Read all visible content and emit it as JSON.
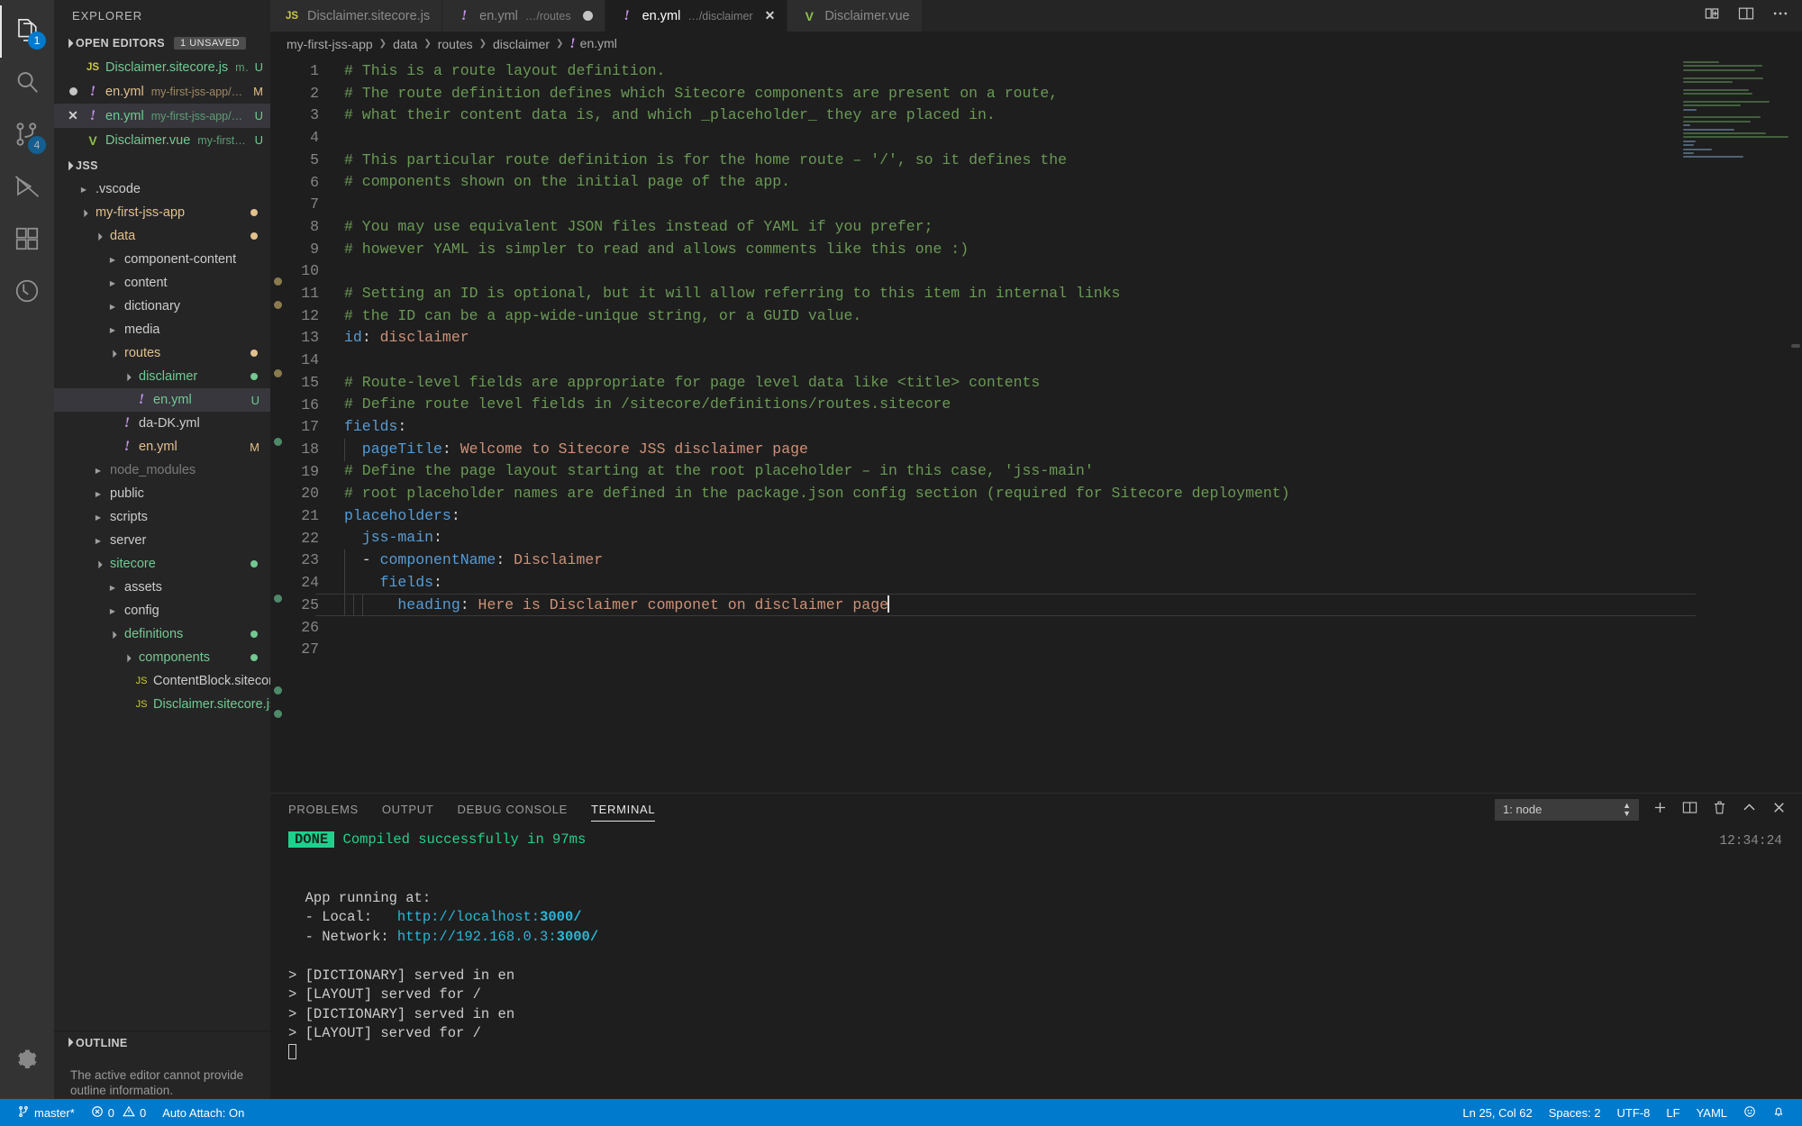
{
  "activitybar": {
    "items": [
      {
        "name": "explorer",
        "icon": "files-icon",
        "badge": "1",
        "active": true
      },
      {
        "name": "search",
        "icon": "search-icon",
        "badge": null,
        "active": false
      },
      {
        "name": "source-control",
        "icon": "source-control-icon",
        "badge": "4",
        "active": false
      },
      {
        "name": "run-debug",
        "icon": "run-debug-icon",
        "badge": null,
        "active": false
      },
      {
        "name": "extensions",
        "icon": "extensions-icon",
        "badge": null,
        "active": false
      },
      {
        "name": "test",
        "icon": "beaker-icon",
        "badge": null,
        "active": false
      }
    ],
    "bottom": [
      {
        "name": "manage-settings",
        "icon": "gear-icon"
      }
    ]
  },
  "sidebar": {
    "title": "EXPLORER",
    "open_editors": {
      "label": "OPEN EDITORS",
      "badge": "1 UNSAVED",
      "items": [
        {
          "action": "",
          "icon": "js-icon",
          "name": "Disclaimer.sitecore.js",
          "path": "my-first…",
          "flag": "U",
          "name_color": "green",
          "path_color": "green",
          "selected": false
        },
        {
          "action": "dot",
          "icon": "yml-icon",
          "name": "en.yml",
          "path": "my-first-jss-app/data/r…",
          "flag": "M",
          "name_color": "orange",
          "path_color": "orange",
          "selected": false
        },
        {
          "action": "close",
          "icon": "yml-icon",
          "name": "en.yml",
          "path": "my-first-jss-app/data/ro…",
          "flag": "U",
          "name_color": "green",
          "path_color": "green",
          "selected": true
        },
        {
          "action": "",
          "icon": "vue-icon",
          "name": "Disclaimer.vue",
          "path": "my-first-jss-ap…",
          "flag": "U",
          "name_color": "green",
          "path_color": "green",
          "selected": false
        }
      ]
    },
    "workspace": {
      "label": "JSS",
      "tree": [
        {
          "depth": 1,
          "arrow": "closed",
          "label": ".vscode",
          "color": "#cccccc",
          "flag": "",
          "dot": ""
        },
        {
          "depth": 1,
          "arrow": "open",
          "label": "my-first-jss-app",
          "color": "#e2c08d",
          "flag": "",
          "dot": "#e2c08d"
        },
        {
          "depth": 2,
          "arrow": "open",
          "label": "data",
          "color": "#e2c08d",
          "flag": "",
          "dot": "#e2c08d"
        },
        {
          "depth": 3,
          "arrow": "closed",
          "label": "component-content",
          "color": "#cccccc",
          "flag": "",
          "dot": ""
        },
        {
          "depth": 3,
          "arrow": "closed",
          "label": "content",
          "color": "#cccccc",
          "flag": "",
          "dot": ""
        },
        {
          "depth": 3,
          "arrow": "closed",
          "label": "dictionary",
          "color": "#cccccc",
          "flag": "",
          "dot": ""
        },
        {
          "depth": 3,
          "arrow": "closed",
          "label": "media",
          "color": "#cccccc",
          "flag": "",
          "dot": ""
        },
        {
          "depth": 3,
          "arrow": "open",
          "label": "routes",
          "color": "#e2c08d",
          "flag": "",
          "dot": "#e2c08d"
        },
        {
          "depth": 4,
          "arrow": "open",
          "label": "disclaimer",
          "color": "#73c991",
          "flag": "",
          "dot": "#73c991"
        },
        {
          "depth": 5,
          "arrow": "file-yml",
          "label": "en.yml",
          "color": "#73c991",
          "flag": "U",
          "dot": "",
          "selected": true
        },
        {
          "depth": 4,
          "arrow": "file-yml",
          "label": "da-DK.yml",
          "color": "#cccccc",
          "flag": "",
          "dot": ""
        },
        {
          "depth": 4,
          "arrow": "file-yml",
          "label": "en.yml",
          "color": "#e2c08d",
          "flag": "M",
          "dot": ""
        },
        {
          "depth": 2,
          "arrow": "closed",
          "label": "node_modules",
          "color": "#7a7a7a",
          "flag": "",
          "dot": ""
        },
        {
          "depth": 2,
          "arrow": "closed",
          "label": "public",
          "color": "#cccccc",
          "flag": "",
          "dot": ""
        },
        {
          "depth": 2,
          "arrow": "closed",
          "label": "scripts",
          "color": "#cccccc",
          "flag": "",
          "dot": ""
        },
        {
          "depth": 2,
          "arrow": "closed",
          "label": "server",
          "color": "#cccccc",
          "flag": "",
          "dot": ""
        },
        {
          "depth": 2,
          "arrow": "open",
          "label": "sitecore",
          "color": "#73c991",
          "flag": "",
          "dot": "#73c991"
        },
        {
          "depth": 3,
          "arrow": "closed",
          "label": "assets",
          "color": "#cccccc",
          "flag": "",
          "dot": ""
        },
        {
          "depth": 3,
          "arrow": "closed",
          "label": "config",
          "color": "#cccccc",
          "flag": "",
          "dot": ""
        },
        {
          "depth": 3,
          "arrow": "open",
          "label": "definitions",
          "color": "#73c991",
          "flag": "",
          "dot": "#73c991"
        },
        {
          "depth": 4,
          "arrow": "open",
          "label": "components",
          "color": "#73c991",
          "flag": "",
          "dot": "#73c991"
        },
        {
          "depth": 5,
          "arrow": "file-js",
          "label": "ContentBlock.sitecore.js",
          "color": "#cccccc",
          "flag": "",
          "dot": ""
        },
        {
          "depth": 5,
          "arrow": "file-js",
          "label": "Disclaimer.sitecore.js",
          "color": "#73c991",
          "flag": "U",
          "dot": ""
        }
      ]
    },
    "outline": {
      "label": "OUTLINE",
      "message": "The active editor cannot provide outline information."
    }
  },
  "tabs": [
    {
      "icon": "js-icon",
      "label": "Disclaimer.sitecore.js",
      "sub": "",
      "state": "",
      "active": false
    },
    {
      "icon": "yml-icon",
      "label": "en.yml",
      "sub": "…/routes",
      "state": "dirty",
      "active": false
    },
    {
      "icon": "yml-icon",
      "label": "en.yml",
      "sub": "…/disclaimer",
      "state": "close",
      "active": true
    },
    {
      "icon": "vue-icon",
      "label": "Disclaimer.vue",
      "sub": "",
      "state": "",
      "active": false
    }
  ],
  "tab_actions": [
    {
      "name": "split-editor-icon"
    },
    {
      "name": "layout-icon"
    },
    {
      "name": "more-actions-icon"
    }
  ],
  "breadcrumbs": [
    {
      "label": "my-first-jss-app",
      "icon": ""
    },
    {
      "label": "data",
      "icon": ""
    },
    {
      "label": "routes",
      "icon": ""
    },
    {
      "label": "disclaimer",
      "icon": ""
    },
    {
      "label": "en.yml",
      "icon": "yml-icon"
    }
  ],
  "editor": {
    "language": "yaml",
    "lines": [
      {
        "n": 1,
        "tokens": [
          {
            "t": "# This is a route layout definition.",
            "c": "comment"
          }
        ]
      },
      {
        "n": 2,
        "tokens": [
          {
            "t": "# The route definition defines which Sitecore components are present on a route,",
            "c": "comment"
          }
        ]
      },
      {
        "n": 3,
        "tokens": [
          {
            "t": "# what their content data is, and which _placeholder_ they are placed in.",
            "c": "comment"
          }
        ]
      },
      {
        "n": 4,
        "tokens": []
      },
      {
        "n": 5,
        "tokens": [
          {
            "t": "# This particular route definition is for the home route – '/', so it defines the",
            "c": "comment"
          }
        ]
      },
      {
        "n": 6,
        "tokens": [
          {
            "t": "# components shown on the initial page of the app.",
            "c": "comment"
          }
        ]
      },
      {
        "n": 7,
        "tokens": []
      },
      {
        "n": 8,
        "tokens": [
          {
            "t": "# You may use equivalent JSON files instead of YAML if you prefer;",
            "c": "comment"
          }
        ]
      },
      {
        "n": 9,
        "tokens": [
          {
            "t": "# however YAML is simpler to read and allows comments like this one :)",
            "c": "comment"
          }
        ]
      },
      {
        "n": 10,
        "tokens": []
      },
      {
        "n": 11,
        "tokens": [
          {
            "t": "# Setting an ID is optional, but it will allow referring to this item in internal links",
            "c": "comment"
          }
        ]
      },
      {
        "n": 12,
        "tokens": [
          {
            "t": "# the ID can be a app-wide-unique string, or a GUID value.",
            "c": "comment"
          }
        ]
      },
      {
        "n": 13,
        "tokens": [
          {
            "t": "id",
            "c": "key"
          },
          {
            "t": ":",
            "c": "punct"
          },
          {
            "t": " disclaimer",
            "c": "str"
          }
        ]
      },
      {
        "n": 14,
        "tokens": []
      },
      {
        "n": 15,
        "tokens": [
          {
            "t": "# Route-level fields are appropriate for page level data like <title> contents",
            "c": "comment"
          }
        ]
      },
      {
        "n": 16,
        "tokens": [
          {
            "t": "# Define route level fields in /sitecore/definitions/routes.sitecore",
            "c": "comment"
          }
        ]
      },
      {
        "n": 17,
        "tokens": [
          {
            "t": "fields",
            "c": "key"
          },
          {
            "t": ":",
            "c": "punct"
          }
        ]
      },
      {
        "n": 18,
        "tokens": [
          {
            "t": "  pageTitle",
            "c": "key"
          },
          {
            "t": ":",
            "c": "punct"
          },
          {
            "t": " Welcome to Sitecore JSS disclaimer page",
            "c": "str"
          }
        ]
      },
      {
        "n": 19,
        "tokens": [
          {
            "t": "# Define the page layout starting at the root placeholder – in this case, 'jss-main'",
            "c": "comment"
          }
        ]
      },
      {
        "n": 20,
        "tokens": [
          {
            "t": "# root placeholder names are defined in the package.json config section (required for Sitecore deployment)",
            "c": "comment"
          }
        ]
      },
      {
        "n": 21,
        "tokens": [
          {
            "t": "placeholders",
            "c": "key"
          },
          {
            "t": ":",
            "c": "punct"
          }
        ]
      },
      {
        "n": 22,
        "tokens": [
          {
            "t": "  jss-main",
            "c": "key"
          },
          {
            "t": ":",
            "c": "punct"
          }
        ]
      },
      {
        "n": 23,
        "tokens": [
          {
            "t": "  - ",
            "c": "dash"
          },
          {
            "t": "componentName",
            "c": "key"
          },
          {
            "t": ":",
            "c": "punct"
          },
          {
            "t": " Disclaimer",
            "c": "str"
          }
        ]
      },
      {
        "n": 24,
        "tokens": [
          {
            "t": "    fields",
            "c": "key"
          },
          {
            "t": ":",
            "c": "punct"
          }
        ]
      },
      {
        "n": 25,
        "tokens": [
          {
            "t": "      heading",
            "c": "key"
          },
          {
            "t": ":",
            "c": "punct"
          },
          {
            "t": " Here is Disclaimer componet on disclaimer page",
            "c": "str"
          }
        ],
        "current": true,
        "cursor": true
      },
      {
        "n": 26,
        "tokens": []
      },
      {
        "n": 27,
        "tokens": []
      }
    ]
  },
  "panel": {
    "tabs": [
      {
        "label": "PROBLEMS",
        "active": false
      },
      {
        "label": "OUTPUT",
        "active": false
      },
      {
        "label": "DEBUG CONSOLE",
        "active": false
      },
      {
        "label": "TERMINAL",
        "active": true
      }
    ],
    "terminal_select": "1: node",
    "actions": [
      {
        "name": "new-terminal-icon",
        "glyph": "+"
      },
      {
        "name": "split-terminal-icon",
        "glyph": "split"
      },
      {
        "name": "kill-terminal-icon",
        "glyph": "trash"
      },
      {
        "name": "maximize-panel-icon",
        "glyph": "chevron-up"
      },
      {
        "name": "close-panel-icon",
        "glyph": "x"
      }
    ],
    "clock": "12:34:24",
    "terminal_lines": [
      {
        "type": "done",
        "badge": "DONE",
        "text": "Compiled successfully in 97ms"
      },
      {
        "type": "blank"
      },
      {
        "type": "blank"
      },
      {
        "type": "plain",
        "text": "  App running at:"
      },
      {
        "type": "link",
        "prefix": "  - Local:   ",
        "url": "http://localhost:",
        "port": "3000/"
      },
      {
        "type": "link",
        "prefix": "  - Network: ",
        "url": "http://192.168.0.3:",
        "port": "3000/"
      },
      {
        "type": "blank"
      },
      {
        "type": "plain",
        "text": "> [DICTIONARY] served in en"
      },
      {
        "type": "plain",
        "text": "> [LAYOUT] served for /"
      },
      {
        "type": "plain",
        "text": "> [DICTIONARY] served in en"
      },
      {
        "type": "plain",
        "text": "> [LAYOUT] served for /"
      },
      {
        "type": "cursor"
      }
    ]
  },
  "statusbar": {
    "left": [
      {
        "name": "branch",
        "icon": "source-control-icon",
        "label": "master*"
      },
      {
        "name": "problems",
        "icon": "error-warning",
        "label": "0  0",
        "errors": "0",
        "warnings": "0"
      },
      {
        "name": "auto-attach",
        "icon": "",
        "label": "Auto Attach: On"
      }
    ],
    "right": [
      {
        "name": "cursor-position",
        "label": "Ln 25, Col 62"
      },
      {
        "name": "indentation",
        "label": "Spaces: 2"
      },
      {
        "name": "encoding",
        "label": "UTF-8"
      },
      {
        "name": "eol",
        "label": "LF"
      },
      {
        "name": "language-mode",
        "label": "YAML"
      },
      {
        "name": "feedback",
        "icon": "smiley-icon",
        "label": ""
      },
      {
        "name": "notifications",
        "icon": "bell-icon",
        "label": ""
      }
    ]
  },
  "colors": {
    "accent": "#007acc",
    "comment": "#6a9955",
    "key": "#569cd6",
    "string": "#ce9178",
    "green_file": "#73c991",
    "orange_file": "#e2c08d",
    "terminal_green": "#23d18b",
    "terminal_blue": "#29b8db",
    "done_badge": "#1dd18c"
  }
}
